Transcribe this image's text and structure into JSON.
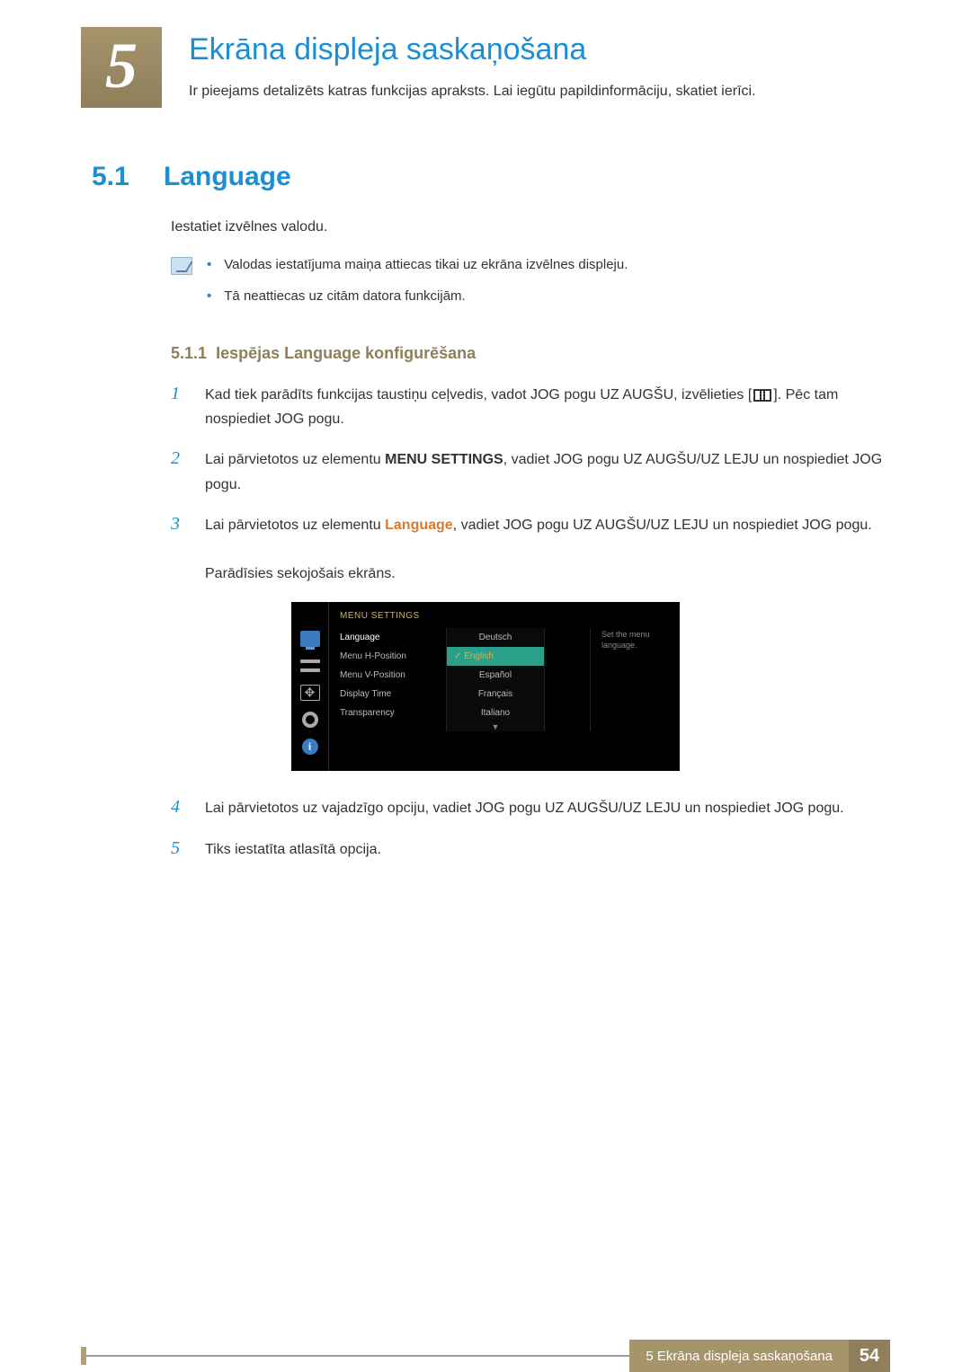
{
  "chapter": {
    "number": "5",
    "title": "Ekrāna displeja saskaņošana",
    "subtitle": "Ir pieejams detalizēts katras funkcijas apraksts. Lai iegūtu papildinformāciju, skatiet ierīci."
  },
  "section": {
    "number": "5.1",
    "title": "Language",
    "intro": "Iestatiet izvēlnes valodu.",
    "notes": [
      "Valodas iestatījuma maiņa attiecas tikai uz ekrāna izvēlnes displeju.",
      "Tā neattiecas uz citām datora funkcijām."
    ]
  },
  "subsection": {
    "number": "5.1.1",
    "title": "Iespējas Language konfigurēšana"
  },
  "steps": {
    "s1a": "Kad tiek parādīts funkcijas taustiņu ceļvedis, vadot JOG pogu UZ AUGŠU, izvēlieties [",
    "s1b": "]. Pēc tam nospiediet JOG pogu.",
    "s2a": "Lai pārvietotos uz elementu ",
    "s2_bold": "MENU SETTINGS",
    "s2b": ", vadiet JOG pogu UZ AUGŠU/UZ LEJU un nospiediet JOG pogu.",
    "s3a": "Lai pārvietotos uz elementu ",
    "s3_orange": "Language",
    "s3b": ", vadiet JOG pogu UZ AUGŠU/UZ LEJU un nospiediet JOG pogu.",
    "s3c": "Parādīsies sekojošais ekrāns.",
    "s4": "Lai pārvietotos uz vajadzīgo opciju, vadiet JOG pogu UZ AUGŠU/UZ LEJU un nospiediet JOG pogu.",
    "s5": "Tiks iestatīta atlasītā opcija.",
    "n1": "1",
    "n2": "2",
    "n3": "3",
    "n4": "4",
    "n5": "5"
  },
  "osd": {
    "header": "MENU SETTINGS",
    "menu_items": [
      "Language",
      "Menu H-Position",
      "Menu V-Position",
      "Display Time",
      "Transparency"
    ],
    "languages": [
      "Deutsch",
      "English",
      "Español",
      "Français",
      "Italiano"
    ],
    "selected_language_index": 1,
    "arrow_down": "▼",
    "description": "Set the menu language."
  },
  "footer": {
    "text": "5 Ekrāna displeja saskaņošana",
    "page": "54"
  }
}
